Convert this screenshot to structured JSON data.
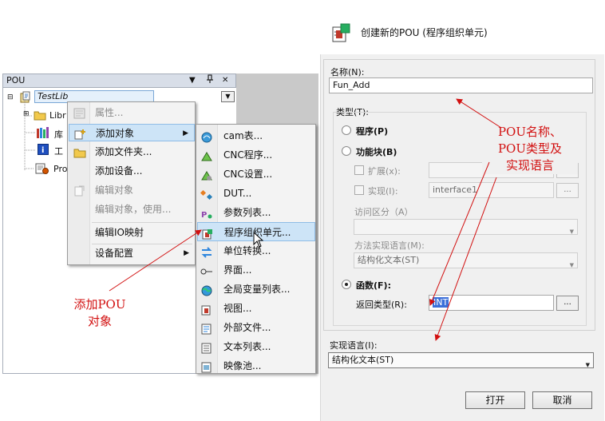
{
  "pou_panel": {
    "title": "POU",
    "pin_icon": "pin-icon",
    "close_icon": "close-icon",
    "tree": {
      "root": "TestLib",
      "items": [
        "Libr",
        "库",
        "工",
        "Pro"
      ],
      "expanders": [
        "⊟",
        "⊞",
        "⊞"
      ]
    }
  },
  "context_menu": {
    "items": [
      {
        "label": "属性...",
        "disabled": true,
        "icon": "properties-icon"
      },
      {
        "label": "添加对象",
        "disabled": false,
        "icon": "add-object-icon",
        "submenu": true
      },
      {
        "label": "添加文件夹...",
        "disabled": false,
        "icon": "folder-icon"
      },
      {
        "label": "添加设备...",
        "disabled": false,
        "icon": ""
      },
      {
        "label": "编辑对象",
        "disabled": true,
        "icon": "edit-object-icon"
      },
      {
        "label": "编辑对象，使用...",
        "disabled": true,
        "icon": ""
      },
      {
        "label": "编辑IO映射",
        "disabled": false,
        "icon": ""
      },
      {
        "label": "设备配置",
        "disabled": false,
        "icon": "",
        "submenu": true
      }
    ]
  },
  "sub_menu": {
    "items": [
      {
        "label": "cam表...",
        "icon": "cam-table-icon"
      },
      {
        "label": "CNC程序...",
        "icon": "cnc-program-icon"
      },
      {
        "label": "CNC设置...",
        "icon": "cnc-settings-icon"
      },
      {
        "label": "DUT...",
        "icon": "dut-icon"
      },
      {
        "label": "参数列表...",
        "icon": "parameter-list-icon"
      },
      {
        "label": "程序组织单元...",
        "icon": "pou-icon"
      },
      {
        "label": "单位转换...",
        "icon": "unit-conversion-icon"
      },
      {
        "label": "界面...",
        "icon": "interface-icon"
      },
      {
        "label": "全局变量列表...",
        "icon": "global-variable-list-icon"
      },
      {
        "label": "视图...",
        "icon": "visualization-icon"
      },
      {
        "label": "外部文件...",
        "icon": "external-file-icon"
      },
      {
        "label": "文本列表...",
        "icon": "text-list-icon"
      },
      {
        "label": "映像池...",
        "icon": "image-pool-icon"
      }
    ]
  },
  "annotations": {
    "add_pou": [
      "添加POU",
      "对象"
    ],
    "pou_name_type": [
      "POU名称、",
      "POU类型及",
      "实现语言"
    ]
  },
  "dialog": {
    "title": "创建新的POU (程序组织单元)",
    "name_label": "名称(N):",
    "name_value": "Fun_Add",
    "type_label": "类型(T):",
    "program_label": "程序(P)",
    "function_block_label": "功能块(B)",
    "extends_label": "扩展(x):",
    "implements_label": "实现(I):",
    "implements_value": "interface1",
    "browse_label": "...",
    "access_label": "访问区分（A）",
    "method_lang_label": "方法实现语言(M):",
    "method_lang_value": "结构化文本(ST)",
    "function_label": "函数(F):",
    "return_type_label": "返回类型(R):",
    "return_type_value": "INT",
    "impl_lang_label": "实现语言(I):",
    "impl_lang_value": "结构化文本(ST)",
    "open_button": "打开",
    "cancel_button": "取消",
    "selected_type": "function"
  },
  "colors": {
    "annotation": "#d21010",
    "menu_highlight": "#cde4f7",
    "panel_header": "#d8dee8"
  }
}
